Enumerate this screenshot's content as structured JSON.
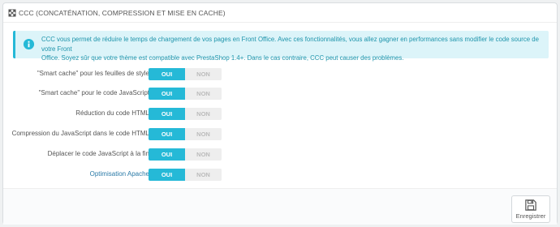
{
  "panel": {
    "title": "CCC (CONCATÉNATION, COMPRESSION ET MISE EN CACHE)",
    "title_icon": "expand-arrows-icon"
  },
  "alert": {
    "icon": "info-circle-icon",
    "line1": "CCC vous permet de réduire le temps de chargement de vos pages en Front Office. Avec ces fonctionnalités, vous allez gagner en performances sans modifier le code source de votre Front",
    "line2": "Office. Soyez sûr que votre thème est compatible avec PrestaShop 1.4+. Dans le cas contraire, CCC peut causer des problèmes."
  },
  "settings": [
    {
      "label": "\"Smart cache\" pour les feuilles de style",
      "on": "OUI",
      "off": "NON",
      "value": "OUI"
    },
    {
      "label": "\"Smart cache\" pour le code JavaScript",
      "on": "OUI",
      "off": "NON",
      "value": "OUI"
    },
    {
      "label": "Réduction du code HTML",
      "on": "OUI",
      "off": "NON",
      "value": "OUI"
    },
    {
      "label": "Compression du JavaScript dans le code HTML",
      "on": "OUI",
      "off": "NON",
      "value": "OUI"
    },
    {
      "label": "Déplacer le code JavaScript à la fin",
      "on": "OUI",
      "off": "NON",
      "value": "OUI"
    },
    {
      "label": "Optimisation Apache",
      "on": "OUI",
      "off": "NON",
      "value": "OUI"
    }
  ],
  "footer": {
    "save_label": "Enregistrer",
    "save_icon": "floppy-disk-icon"
  },
  "colors": {
    "accent": "#25b9d7",
    "alert_bg": "#dcf4f9",
    "alert_text": "#1e94ab"
  }
}
